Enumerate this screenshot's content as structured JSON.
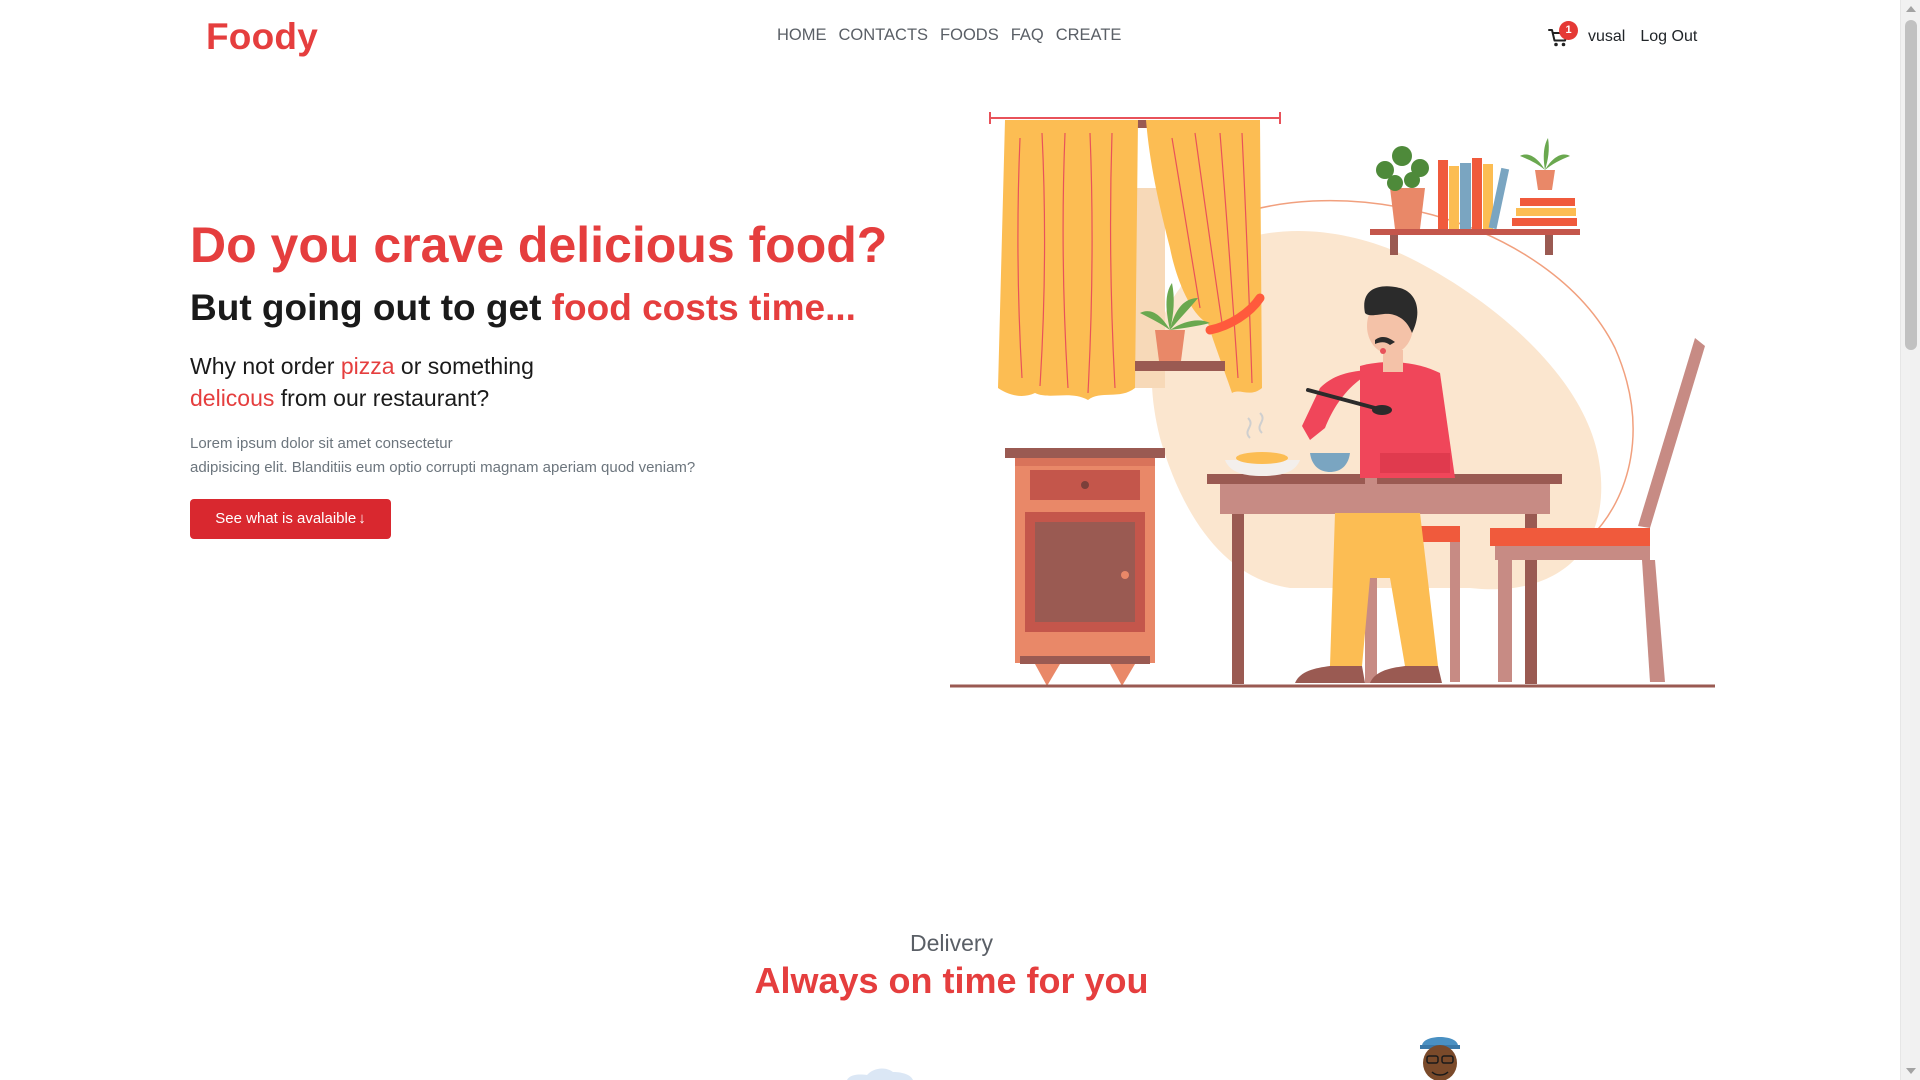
{
  "navbar": {
    "brand": "Foody",
    "links": [
      "HOME",
      "CONTACTS",
      "FOODS",
      "FAQ",
      "CREATE"
    ],
    "cart_count": "1",
    "username": "vusal",
    "logout_label": "Log Out"
  },
  "hero": {
    "title": "Do you crave delicious food?",
    "subtitle_prefix": "But going out to get ",
    "subtitle_highlight": "food costs time...",
    "question_part1": "Why not order ",
    "question_highlight1": "pizza",
    "question_part2": " or something ",
    "question_highlight2": "delicous",
    "question_part3": " from our restaurant?",
    "lorem_line1": "Lorem ipsum dolor sit amet consectetur",
    "lorem_line2": "adipisicing elit. Blanditiis eum optio corrupti magnam aperiam quod veniam?",
    "cta_label": "See what is avalaible",
    "cta_arrow": "↓"
  },
  "delivery": {
    "label": "Delivery",
    "title": "Always on time for you"
  },
  "colors": {
    "brand": "#e53e3e",
    "button": "#d9282f",
    "muted_text": "#6c757d",
    "nav_text": "#5a5f66"
  },
  "icons": [
    "cart-icon",
    "arrow-down-icon"
  ]
}
